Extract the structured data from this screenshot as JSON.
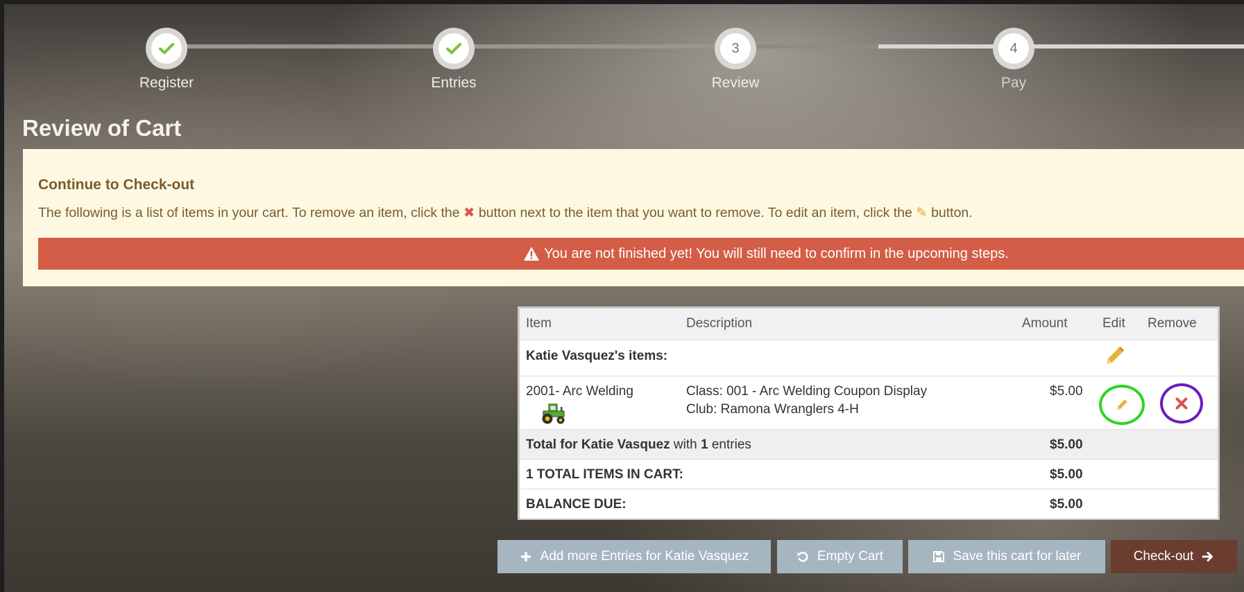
{
  "steps": [
    {
      "label": "Register",
      "state": "done"
    },
    {
      "label": "Entries",
      "state": "done"
    },
    {
      "label": "Review",
      "state": "current",
      "number": "3"
    },
    {
      "label": "Pay",
      "state": "upcoming",
      "number": "4"
    }
  ],
  "page_title": "Review of Cart",
  "panel": {
    "title": "Continue to Check-out",
    "text_before": "The following is a list of items in your cart. To remove an item, click the",
    "x_glyph": "✖",
    "text_middle": "button next to the item that you want to remove. To edit an item, click the",
    "pencil_glyph": "✎",
    "text_after": "button.",
    "alert": "You are not finished yet! You will still need to confirm in the upcoming steps."
  },
  "cart": {
    "headers": {
      "item": "Item",
      "description": "Description",
      "amount": "Amount",
      "edit": "Edit",
      "remove": "Remove"
    },
    "owner_label": "Katie Vasquez's items:",
    "item": {
      "code_name": "2001- Arc Welding",
      "class_line": "Class: 001 - Arc Welding Coupon Display",
      "club_line": "Club: Ramona Wranglers 4-H",
      "amount": "$5.00"
    },
    "total_row": {
      "prefix": "Total for Katie Vasquez",
      "with": "with",
      "count": "1",
      "suffix": "entries",
      "amount": "$5.00"
    },
    "count_row": {
      "label": "1 TOTAL ITEMS IN CART:",
      "amount": "$5.00"
    },
    "balance_row": {
      "label": "BALANCE DUE:",
      "amount": "$5.00"
    }
  },
  "buttons": {
    "add": "Add more Entries for Katie Vasquez",
    "empty": "Empty Cart",
    "save": "Save this cart for later",
    "checkout": "Check-out"
  },
  "colors": {
    "alert": "#d45d47",
    "panel": "#fdf8e2",
    "edit_ring": "#29d623",
    "remove_ring": "#6a1cc0",
    "checkout": "#6a3d2f",
    "secondary_btn": "#a6b6c1"
  }
}
